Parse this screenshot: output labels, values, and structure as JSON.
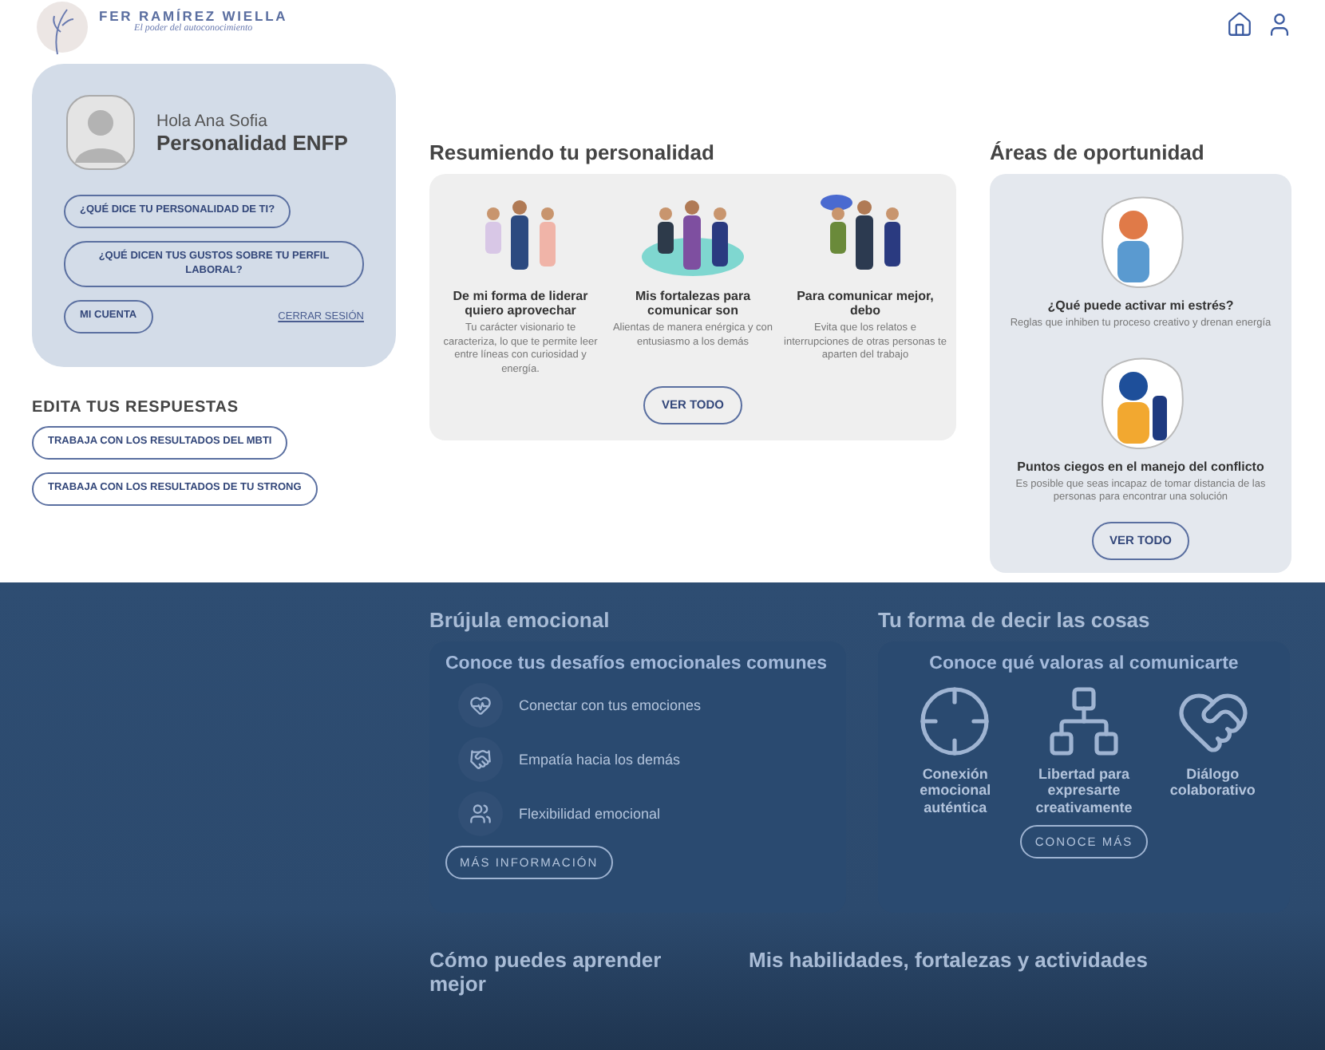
{
  "header": {
    "brand": "FER RAMÍREZ WIELLA",
    "tagline": "El poder del autoconocimiento"
  },
  "profile": {
    "greeting": "Hola Ana Sofia",
    "personality": "Personalidad ENFP",
    "links": [
      "¿QUÉ DICE TU PERSONALIDAD DE TI?",
      "¿QUÉ DICEN TUS GUSTOS SOBRE TU PERFIL LABORAL?"
    ],
    "account": "MI CUENTA",
    "logout": "CERRAR SESIÓN"
  },
  "edit": {
    "title": "EDITA TUS RESPUESTAS",
    "buttons": [
      "TRABAJA CON LOS RESULTADOS DEL MBTI",
      "TRABAJA CON LOS RESULTADOS DE TU STRONG"
    ]
  },
  "summary": {
    "title": "Resumiendo tu personalidad",
    "button": "VER TODO",
    "items": [
      {
        "kind": "leader",
        "title": "De mi forma de liderar quiero aprovechar",
        "text": "Tu carácter visionario te caracteriza, lo que te permite leer entre líneas con curiosidad y energía."
      },
      {
        "kind": "group",
        "title": "Mis fortalezas para comunicar son",
        "text": "Alientas de manera enérgica y con entusiasmo a los demás"
      },
      {
        "kind": "talk",
        "title": "Para comunicar mejor, debo",
        "text": "Evita que los relatos e interrupciones de otras personas te aparten del trabajo"
      }
    ]
  },
  "opportunities": {
    "title": "Áreas de oportunidad",
    "button": "VER TODO",
    "items": [
      {
        "kind": "stress",
        "title": "¿Qué puede activar mi estrés?",
        "text": "Reglas que inhiben tu proceso creativo y drenan energía"
      },
      {
        "kind": "conflict",
        "title": "Puntos ciegos en el manejo del conflicto",
        "text": "Es posible que seas incapaz de tomar distancia de las personas para encontrar una solución"
      }
    ]
  },
  "compass": {
    "title": "Brújula emocional",
    "subtitle": "Conoce tus desafíos emocionales comunes",
    "button": "MÁS INFORMACIÓN",
    "items": [
      {
        "kind": "heart",
        "label": "Conectar con tus emociones"
      },
      {
        "kind": "hands",
        "label": "Empatía hacia los demás"
      },
      {
        "kind": "people",
        "label": "Flexibilidad emocional"
      }
    ]
  },
  "communication": {
    "title": "Tu forma de decir las cosas",
    "subtitle": "Conoce qué valoras al comunicarte",
    "button": "CONOCE MÁS",
    "items": [
      {
        "kind": "target",
        "label": "Conexión emocional auténtica"
      },
      {
        "kind": "chart",
        "label": "Libertad para expresarte creativamente"
      },
      {
        "kind": "heart",
        "label": "Diálogo colaborativo"
      }
    ]
  },
  "learning": {
    "title": "Cómo puedes aprender mejor"
  },
  "skills": {
    "title": "Mis habilidades, fortalezas y actividades"
  },
  "backdrop": {
    "visible": true
  }
}
